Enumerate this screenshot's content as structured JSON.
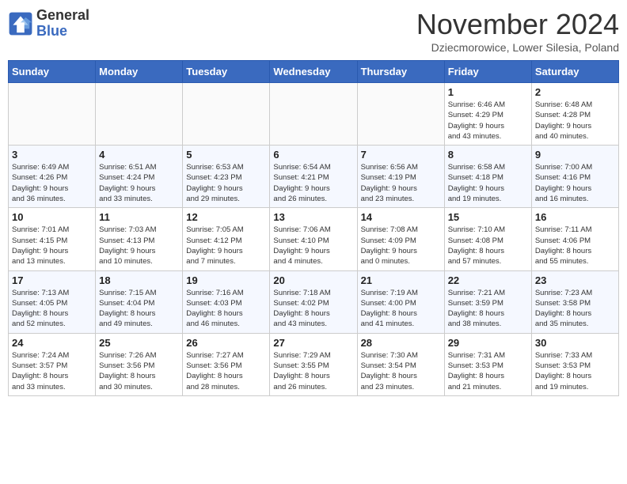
{
  "header": {
    "logo_line1": "General",
    "logo_line2": "Blue",
    "month_title": "November 2024",
    "subtitle": "Dziecmorowice, Lower Silesia, Poland"
  },
  "weekdays": [
    "Sunday",
    "Monday",
    "Tuesday",
    "Wednesday",
    "Thursday",
    "Friday",
    "Saturday"
  ],
  "weeks": [
    [
      {
        "day": "",
        "info": ""
      },
      {
        "day": "",
        "info": ""
      },
      {
        "day": "",
        "info": ""
      },
      {
        "day": "",
        "info": ""
      },
      {
        "day": "",
        "info": ""
      },
      {
        "day": "1",
        "info": "Sunrise: 6:46 AM\nSunset: 4:29 PM\nDaylight: 9 hours\nand 43 minutes."
      },
      {
        "day": "2",
        "info": "Sunrise: 6:48 AM\nSunset: 4:28 PM\nDaylight: 9 hours\nand 40 minutes."
      }
    ],
    [
      {
        "day": "3",
        "info": "Sunrise: 6:49 AM\nSunset: 4:26 PM\nDaylight: 9 hours\nand 36 minutes."
      },
      {
        "day": "4",
        "info": "Sunrise: 6:51 AM\nSunset: 4:24 PM\nDaylight: 9 hours\nand 33 minutes."
      },
      {
        "day": "5",
        "info": "Sunrise: 6:53 AM\nSunset: 4:23 PM\nDaylight: 9 hours\nand 29 minutes."
      },
      {
        "day": "6",
        "info": "Sunrise: 6:54 AM\nSunset: 4:21 PM\nDaylight: 9 hours\nand 26 minutes."
      },
      {
        "day": "7",
        "info": "Sunrise: 6:56 AM\nSunset: 4:19 PM\nDaylight: 9 hours\nand 23 minutes."
      },
      {
        "day": "8",
        "info": "Sunrise: 6:58 AM\nSunset: 4:18 PM\nDaylight: 9 hours\nand 19 minutes."
      },
      {
        "day": "9",
        "info": "Sunrise: 7:00 AM\nSunset: 4:16 PM\nDaylight: 9 hours\nand 16 minutes."
      }
    ],
    [
      {
        "day": "10",
        "info": "Sunrise: 7:01 AM\nSunset: 4:15 PM\nDaylight: 9 hours\nand 13 minutes."
      },
      {
        "day": "11",
        "info": "Sunrise: 7:03 AM\nSunset: 4:13 PM\nDaylight: 9 hours\nand 10 minutes."
      },
      {
        "day": "12",
        "info": "Sunrise: 7:05 AM\nSunset: 4:12 PM\nDaylight: 9 hours\nand 7 minutes."
      },
      {
        "day": "13",
        "info": "Sunrise: 7:06 AM\nSunset: 4:10 PM\nDaylight: 9 hours\nand 4 minutes."
      },
      {
        "day": "14",
        "info": "Sunrise: 7:08 AM\nSunset: 4:09 PM\nDaylight: 9 hours\nand 0 minutes."
      },
      {
        "day": "15",
        "info": "Sunrise: 7:10 AM\nSunset: 4:08 PM\nDaylight: 8 hours\nand 57 minutes."
      },
      {
        "day": "16",
        "info": "Sunrise: 7:11 AM\nSunset: 4:06 PM\nDaylight: 8 hours\nand 55 minutes."
      }
    ],
    [
      {
        "day": "17",
        "info": "Sunrise: 7:13 AM\nSunset: 4:05 PM\nDaylight: 8 hours\nand 52 minutes."
      },
      {
        "day": "18",
        "info": "Sunrise: 7:15 AM\nSunset: 4:04 PM\nDaylight: 8 hours\nand 49 minutes."
      },
      {
        "day": "19",
        "info": "Sunrise: 7:16 AM\nSunset: 4:03 PM\nDaylight: 8 hours\nand 46 minutes."
      },
      {
        "day": "20",
        "info": "Sunrise: 7:18 AM\nSunset: 4:02 PM\nDaylight: 8 hours\nand 43 minutes."
      },
      {
        "day": "21",
        "info": "Sunrise: 7:19 AM\nSunset: 4:00 PM\nDaylight: 8 hours\nand 41 minutes."
      },
      {
        "day": "22",
        "info": "Sunrise: 7:21 AM\nSunset: 3:59 PM\nDaylight: 8 hours\nand 38 minutes."
      },
      {
        "day": "23",
        "info": "Sunrise: 7:23 AM\nSunset: 3:58 PM\nDaylight: 8 hours\nand 35 minutes."
      }
    ],
    [
      {
        "day": "24",
        "info": "Sunrise: 7:24 AM\nSunset: 3:57 PM\nDaylight: 8 hours\nand 33 minutes."
      },
      {
        "day": "25",
        "info": "Sunrise: 7:26 AM\nSunset: 3:56 PM\nDaylight: 8 hours\nand 30 minutes."
      },
      {
        "day": "26",
        "info": "Sunrise: 7:27 AM\nSunset: 3:56 PM\nDaylight: 8 hours\nand 28 minutes."
      },
      {
        "day": "27",
        "info": "Sunrise: 7:29 AM\nSunset: 3:55 PM\nDaylight: 8 hours\nand 26 minutes."
      },
      {
        "day": "28",
        "info": "Sunrise: 7:30 AM\nSunset: 3:54 PM\nDaylight: 8 hours\nand 23 minutes."
      },
      {
        "day": "29",
        "info": "Sunrise: 7:31 AM\nSunset: 3:53 PM\nDaylight: 8 hours\nand 21 minutes."
      },
      {
        "day": "30",
        "info": "Sunrise: 7:33 AM\nSunset: 3:53 PM\nDaylight: 8 hours\nand 19 minutes."
      }
    ]
  ]
}
